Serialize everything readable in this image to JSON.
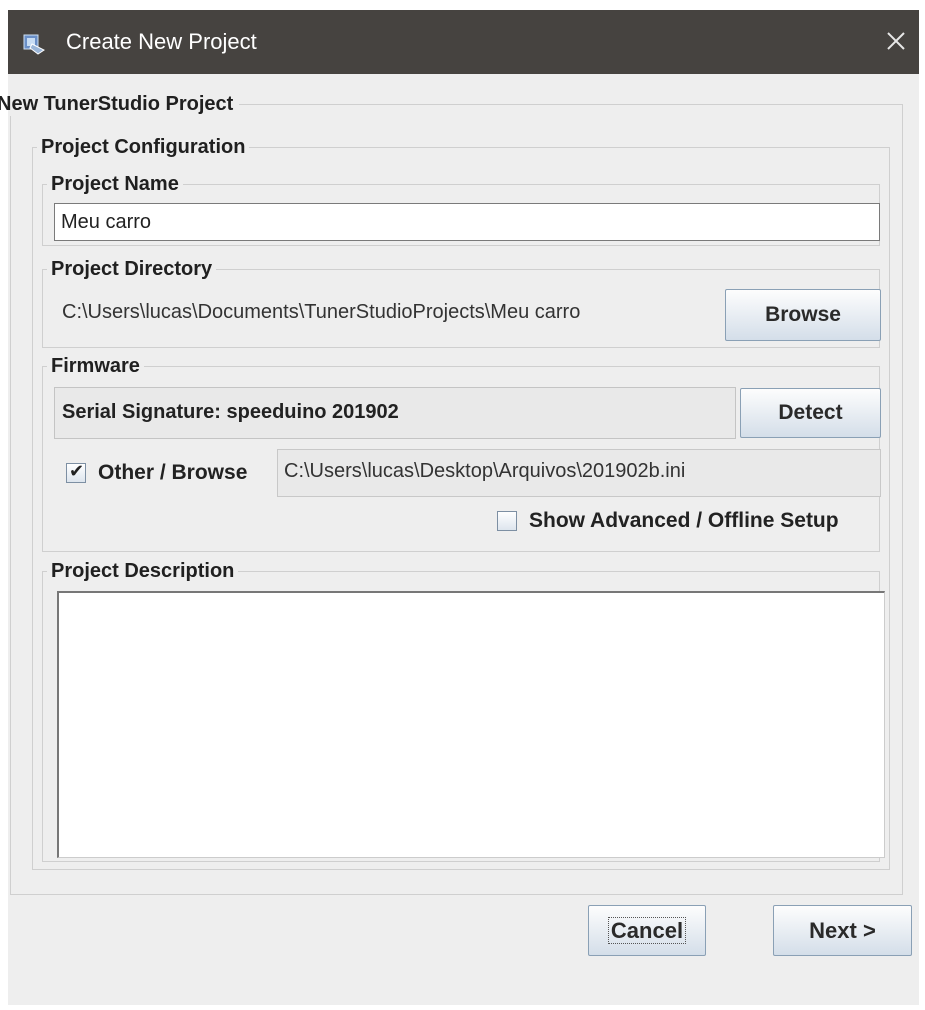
{
  "window": {
    "title": "Create New Project",
    "title_icon": "tunerstudio-app-icon",
    "close_icon": "close-icon"
  },
  "outer_group": {
    "legend": "New TunerStudio Project"
  },
  "config": {
    "legend": "Project Configuration"
  },
  "project_name": {
    "legend": "Project Name",
    "value": "Meu carro"
  },
  "project_directory": {
    "legend": "Project Directory",
    "path": "C:\\Users\\lucas\\Documents\\TunerStudioProjects\\Meu carro",
    "browse_label": "Browse"
  },
  "firmware": {
    "legend": "Firmware",
    "signature": "Serial Signature: speeduino 201902",
    "detect_label": "Detect",
    "other_browse_label": "Other / Browse",
    "other_browse_checked": true,
    "ini_path": "C:\\Users\\lucas\\Desktop\\Arquivos\\201902b.ini",
    "advanced_label": "Show Advanced / Offline Setup",
    "advanced_checked": false
  },
  "description": {
    "legend": "Project Description",
    "value": ""
  },
  "footer": {
    "cancel_label": "Cancel",
    "next_label": "Next >"
  },
  "colors": {
    "titlebar": "#464340",
    "dialog_bg": "#eeeeee",
    "button_gradient_end": "#d4dee9"
  }
}
